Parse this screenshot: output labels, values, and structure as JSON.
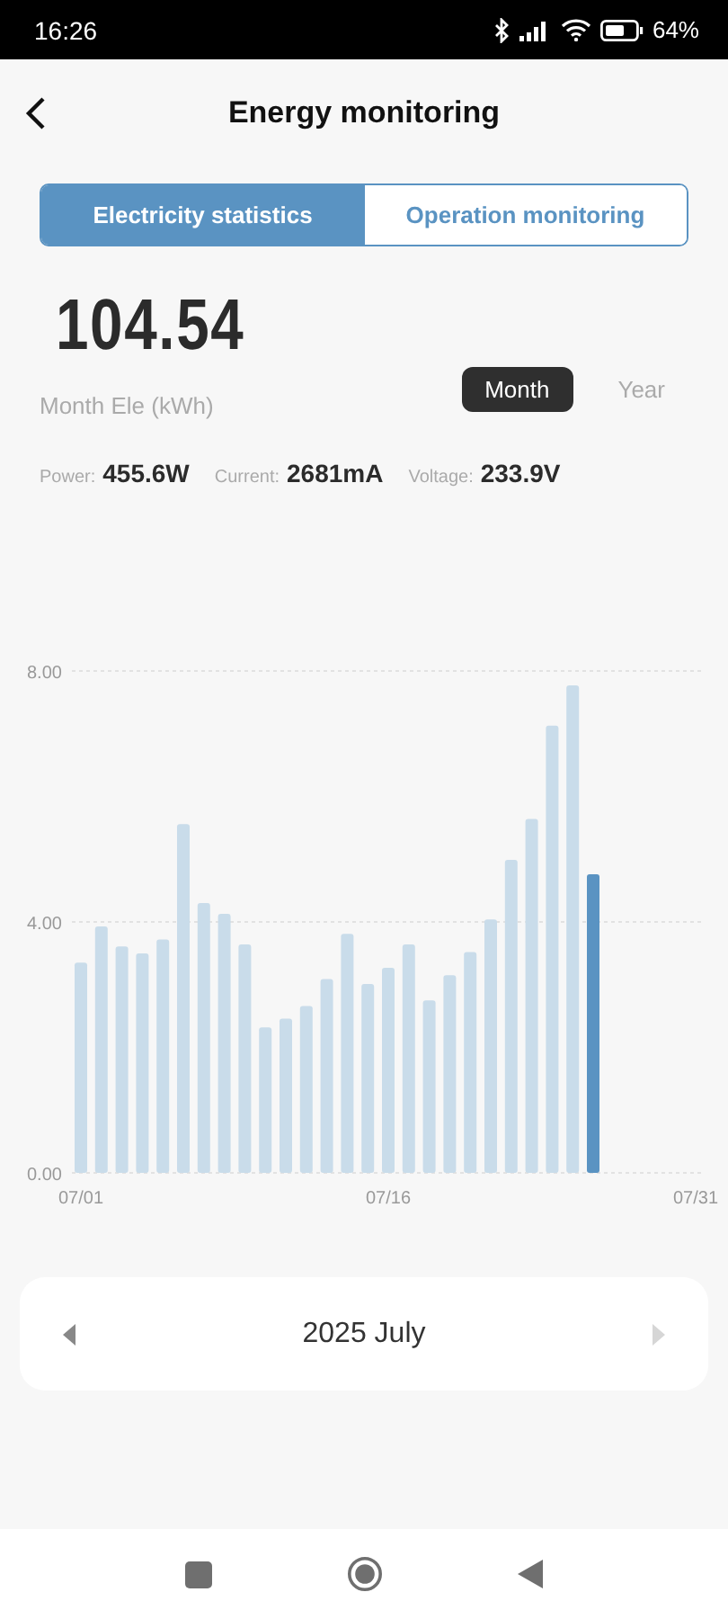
{
  "status_bar": {
    "time": "16:26",
    "battery": "64%"
  },
  "header": {
    "title": "Energy monitoring"
  },
  "tabs": [
    {
      "label": "Electricity statistics",
      "selected": true
    },
    {
      "label": "Operation monitoring",
      "selected": false
    }
  ],
  "summary": {
    "value": "104.54",
    "caption": "Month Ele (kWh)"
  },
  "period_toggle": [
    {
      "label": "Month",
      "selected": true
    },
    {
      "label": "Year",
      "selected": false
    }
  ],
  "readings": [
    {
      "label": "Power:",
      "value": "455.6W"
    },
    {
      "label": "Current:",
      "value": "2681mA"
    },
    {
      "label": "Voltage:",
      "value": "233.9V"
    }
  ],
  "chart": {
    "chart_data": {
      "type": "bar",
      "categories": [
        "07/01",
        null,
        null,
        null,
        null,
        null,
        null,
        null,
        null,
        null,
        null,
        null,
        null,
        null,
        null,
        "07/16",
        null,
        null,
        null,
        null,
        null,
        null,
        null,
        null,
        null,
        null,
        null,
        null,
        null,
        null,
        "07/31"
      ],
      "series": [
        {
          "color": "#c9dcea",
          "values": [
            3.35,
            3.93,
            3.61,
            3.5,
            3.72,
            5.56,
            4.3,
            4.13,
            3.64,
            2.32,
            2.46,
            2.66,
            3.09,
            3.81,
            3.01,
            3.27,
            3.64,
            2.75,
            3.15,
            3.52,
            4.04,
            4.99,
            5.64,
            7.13,
            7.77,
            null,
            null,
            null,
            null,
            null,
            null
          ]
        },
        {
          "color": "#5a93c2",
          "values": [
            null,
            null,
            null,
            null,
            null,
            null,
            null,
            null,
            null,
            null,
            null,
            null,
            null,
            null,
            null,
            null,
            null,
            null,
            null,
            null,
            null,
            null,
            null,
            null,
            null,
            4.76,
            null,
            null,
            null,
            null,
            null
          ]
        }
      ],
      "ylim": [
        0,
        8
      ],
      "yticks": [
        {
          "value": 0,
          "label": "0.00"
        },
        {
          "value": 4,
          "label": "4.00"
        },
        {
          "value": 8,
          "label": "8.00"
        }
      ],
      "stacked": true
    }
  },
  "date_picker": {
    "label": "2025 July",
    "prev_disabled": false,
    "next_disabled": true
  }
}
